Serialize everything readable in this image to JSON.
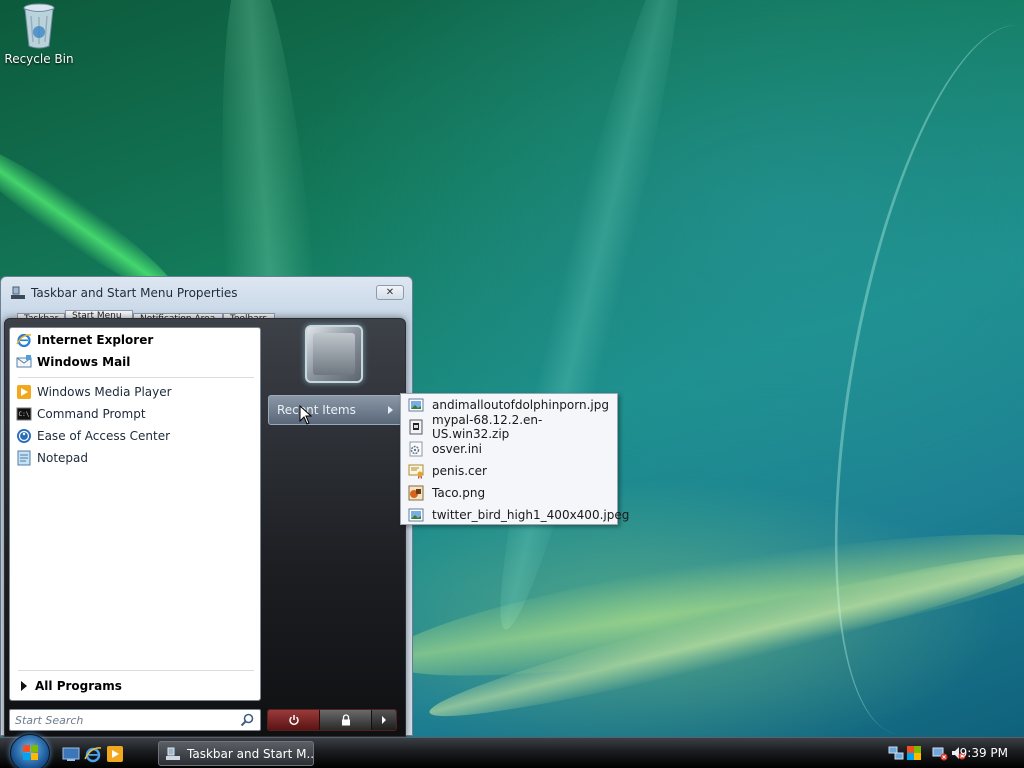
{
  "desktop": {
    "recycle_bin_label": "Recycle Bin"
  },
  "properties_window": {
    "title": "Taskbar and Start Menu Properties",
    "tabs": [
      "Taskbar",
      "Start Menu",
      "Notification Area",
      "Toolbars"
    ],
    "close_glyph": "✕"
  },
  "start_menu": {
    "pinned": [
      {
        "label": "Internet Explorer",
        "icon": "internet-explorer-icon"
      },
      {
        "label": "Windows Mail",
        "icon": "windows-mail-icon"
      }
    ],
    "recent_programs": [
      {
        "label": "Windows Media Player",
        "icon": "media-player-icon"
      },
      {
        "label": "Command Prompt",
        "icon": "command-prompt-icon"
      },
      {
        "label": "Ease of Access Center",
        "icon": "ease-of-access-icon"
      },
      {
        "label": "Notepad",
        "icon": "notepad-icon"
      }
    ],
    "all_programs_label": "All Programs",
    "search_placeholder": "Start Search",
    "recent_items_label": "Recent Items"
  },
  "recent_items_submenu": [
    {
      "label": "andimalloutofdolphinporn.jpg",
      "icon": "image-file-icon"
    },
    {
      "label": "mypal-68.12.2.en-US.win32.zip",
      "icon": "zip-file-icon"
    },
    {
      "label": "osver.ini",
      "icon": "settings-file-icon"
    },
    {
      "label": "penis.cer",
      "icon": "certificate-file-icon"
    },
    {
      "label": "Taco.png",
      "icon": "png-file-icon"
    },
    {
      "label": "twitter_bird_high1_400x400.jpeg",
      "icon": "image-file-icon"
    }
  ],
  "taskbar": {
    "task_button_label": "Taskbar and Start M...",
    "clock": "9:39 PM"
  }
}
